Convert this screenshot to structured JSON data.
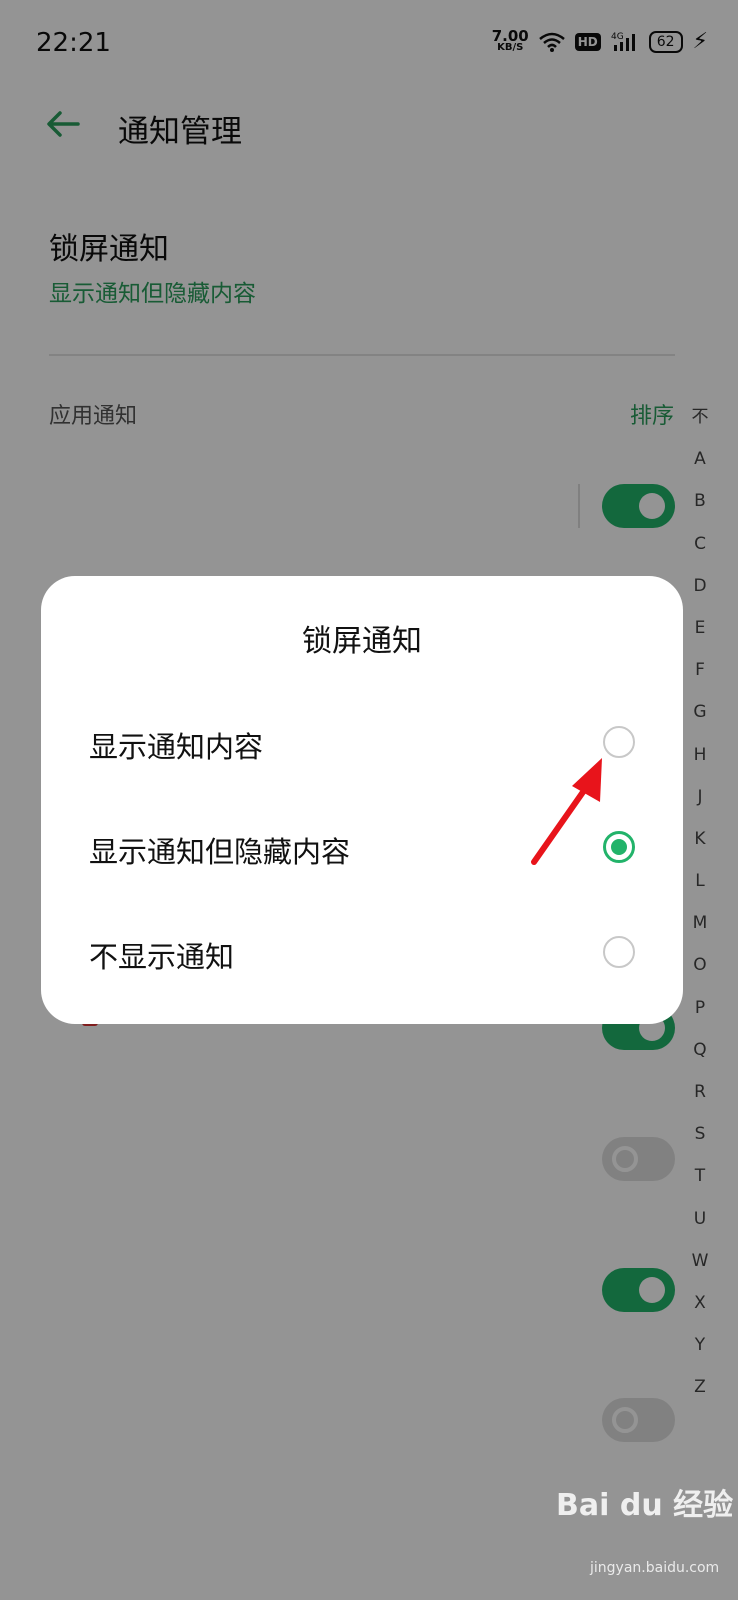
{
  "status_bar": {
    "time": "22:21",
    "net_speed_value": "7.00",
    "net_speed_unit": "KB/S",
    "hd_label": "HD",
    "network_type": "4G",
    "battery_level": "62"
  },
  "header": {
    "title": "通知管理"
  },
  "lock_screen_setting": {
    "title": "锁屏通知",
    "value": "显示通知但隐藏内容"
  },
  "app_notifications": {
    "section_label": "应用通知",
    "sort_label": "排序",
    "toggles": [
      true,
      true,
      false,
      true,
      false
    ]
  },
  "alphabet_index": [
    "不",
    "A",
    "B",
    "C",
    "D",
    "E",
    "F",
    "G",
    "H",
    "J",
    "K",
    "L",
    "M",
    "O",
    "P",
    "Q",
    "R",
    "S",
    "T",
    "U",
    "W",
    "X",
    "Y",
    "Z"
  ],
  "dialog": {
    "title": "锁屏通知",
    "options": [
      {
        "label": "显示通知内容",
        "selected": false
      },
      {
        "label": "显示通知但隐藏内容",
        "selected": true
      },
      {
        "label": "不显示通知",
        "selected": false
      }
    ]
  },
  "watermark": {
    "brand": "Bai du 经验",
    "url": "jingyan.baidu.com"
  },
  "colors": {
    "accent": "#22b36a",
    "accent_text": "#2a9d5c",
    "annotation_arrow": "#e8141b"
  }
}
